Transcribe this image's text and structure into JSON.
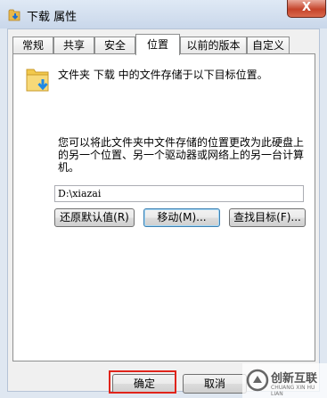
{
  "window": {
    "title": "下载 属性",
    "close_label": "X"
  },
  "tabs": [
    {
      "label": "常规"
    },
    {
      "label": "共享"
    },
    {
      "label": "安全"
    },
    {
      "label": "位置",
      "active": true
    },
    {
      "label": "以前的版本"
    },
    {
      "label": "自定义"
    }
  ],
  "location": {
    "header": "文件夹 下载 中的文件存储于以下目标位置。",
    "description_line1": "您可以将此文件夹中文件存储的位置更改为此硬盘上",
    "description_line2": "的另一个位置、另一个驱动器或网络上的另一台计算",
    "description_line3": "机。",
    "path_value": "D:\\xiazai",
    "restore_label": "还原默认值(R)",
    "move_label": "移动(M)...",
    "find_target_label": "查找目标(F)..."
  },
  "footer": {
    "ok_label": "确定",
    "cancel_label": "取消"
  },
  "watermark": {
    "text": "创新互联",
    "subtext": "CHUANG XIN HU LIAN"
  },
  "colors": {
    "highlight_outline": "#e0241b",
    "folder": "#f2c94c",
    "arrow": "#1e88e5"
  }
}
